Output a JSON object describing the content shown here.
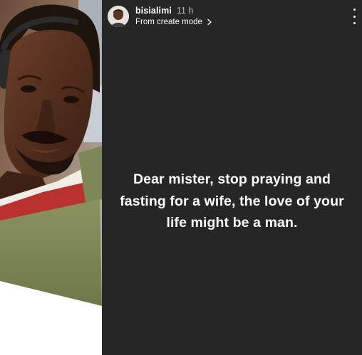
{
  "story": {
    "username": "bisialimi",
    "timestamp": "11 h",
    "source_label": "From create mode",
    "text": "Dear mister, stop praying and fasting for a wife, the love of your life might be a man."
  },
  "icons": {
    "more": "more-options-icon",
    "chevron": "chevron-right-icon"
  },
  "colors": {
    "story_background": "#262626",
    "text": "#ffffff",
    "timestamp": "#bdbdbd"
  }
}
